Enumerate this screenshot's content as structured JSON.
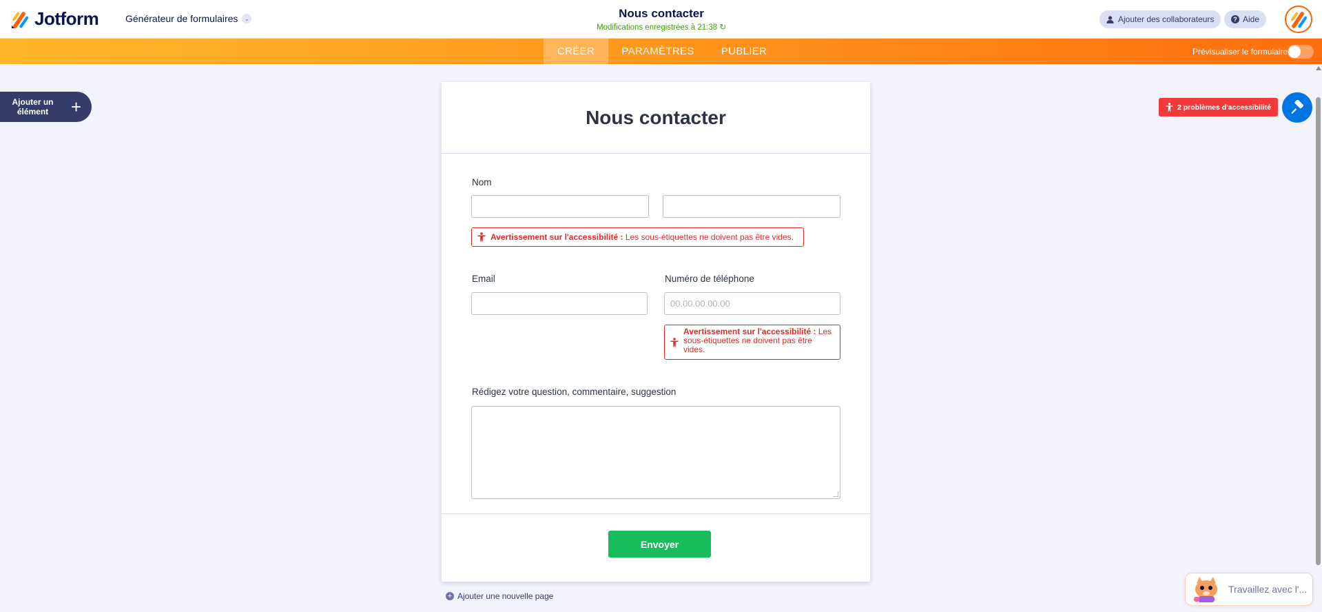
{
  "header": {
    "brand": "Jotform",
    "builder_menu": "Générateur de formulaires",
    "form_title": "Nous contacter",
    "saved_status": "Modifications enregistrées à 21:38",
    "collaborators_label": "Ajouter des collaborateurs",
    "help_label": "Aide"
  },
  "nav": {
    "tabs": [
      {
        "label": "CRÉER",
        "active": true
      },
      {
        "label": "PARAMÈTRES",
        "active": false
      },
      {
        "label": "PUBLIER",
        "active": false
      }
    ],
    "preview_label": "Prévisualiser le formulaire",
    "preview_enabled": false
  },
  "sidebar": {
    "add_element_label": "Ajouter un élément"
  },
  "accessibility": {
    "badge_label": "2 problèmes d'accessibilité"
  },
  "form": {
    "heading": "Nous contacter",
    "name_label": "Nom",
    "name_warning_strong": "Avertissement sur l'accessibilité :",
    "name_warning_text": " Les sous-étiquettes ne doivent pas être vides.",
    "email_label": "Email",
    "phone_label": "Numéro de téléphone",
    "phone_placeholder": "00.00.00.00.00",
    "phone_warning_strong": "Avertissement sur l'accessibilité :",
    "phone_warning_text": " Les sous-étiquettes ne doivent pas être vides.",
    "question_label": "Rédigez votre question, commentaire, suggestion",
    "submit_label": "Envoyer"
  },
  "add_page_label": "Ajouter une nouvelle page",
  "ai_agent": {
    "label": "Travaillez avec l'..."
  },
  "colors": {
    "brand_navy": "#0a1551",
    "nav_orange_start": "#ffb629",
    "nav_orange_end": "#ff6e0e",
    "warning_red": "#e02a2a",
    "badge_red": "#f23a3c",
    "submit_green": "#18bd5b",
    "designer_blue": "#0075e3"
  }
}
